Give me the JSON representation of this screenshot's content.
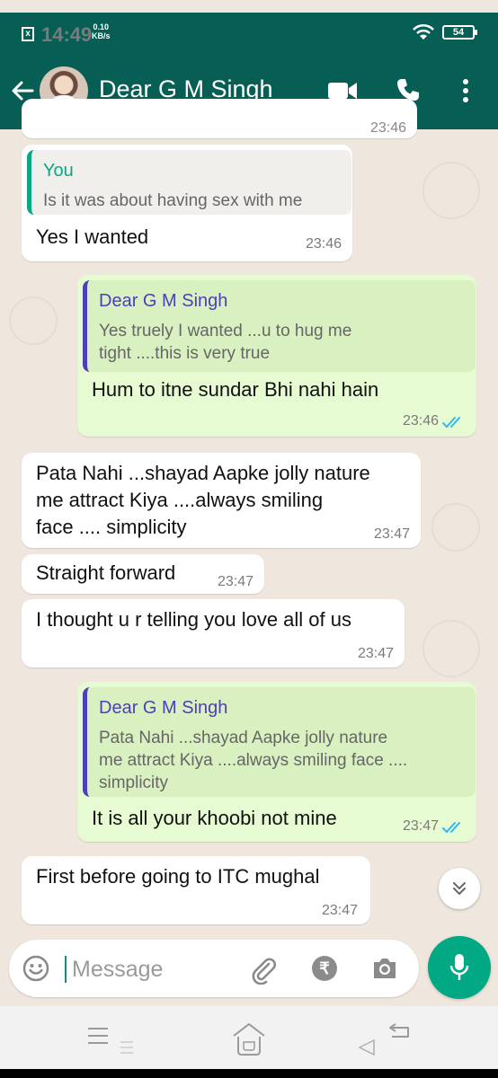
{
  "status_bar": {
    "time": "14:49",
    "speed_value": "0.10",
    "speed_unit": "KB/s",
    "battery": "54",
    "sim_icon": "x-box-icon",
    "wifi_icon": "wifi-icon"
  },
  "header": {
    "contact_name": "Dear G M Singh",
    "icons": [
      "back-arrow-icon",
      "avatar",
      "video-call-icon",
      "phone-icon",
      "more-vert-icon"
    ]
  },
  "partial_top_time": "23:46",
  "messages": [
    {
      "direction": "in",
      "quote": {
        "author": "You",
        "text": "Is it was about having sex with me"
      },
      "text": "Yes I wanted",
      "time": "23:46"
    },
    {
      "direction": "out",
      "quote": {
        "author": "Dear G M Singh",
        "text": "Yes truely I wanted ...u to hug me\ntight ....this is very true"
      },
      "text": "Hum to itne sundar Bhi nahi hain",
      "time": "23:46",
      "read": true
    },
    {
      "direction": "in",
      "text": "Pata Nahi ...shayad Aapke jolly nature\nme attract Kiya ....always smiling\nface .... simplicity",
      "time": "23:47"
    },
    {
      "direction": "in",
      "text": "Straight forward",
      "time": "23:47"
    },
    {
      "direction": "in",
      "text": "I thought u r telling you love all of us",
      "time": "23:47"
    },
    {
      "direction": "out",
      "quote": {
        "author": "Dear G M Singh",
        "text": "Pata Nahi ...shayad Aapke jolly nature\nme attract Kiya ....always smiling face ....\nsimplicity"
      },
      "text": "It is all your khoobi not mine",
      "time": "23:47",
      "read": true
    },
    {
      "direction": "in",
      "text": "First before going to ITC mughal",
      "time": "23:47"
    }
  ],
  "composer": {
    "placeholder": "Message",
    "icons": [
      "emoji-icon",
      "attach-icon",
      "rupee-icon",
      "camera-icon",
      "mic-icon"
    ]
  },
  "colors": {
    "header": "#075e54",
    "incoming": "#ffffff",
    "outgoing": "#e7fbd3",
    "quote_self": "#06a884",
    "quote_other": "#4d3fb8",
    "read_ticks": "#34b7f1",
    "mic": "#00a884"
  }
}
